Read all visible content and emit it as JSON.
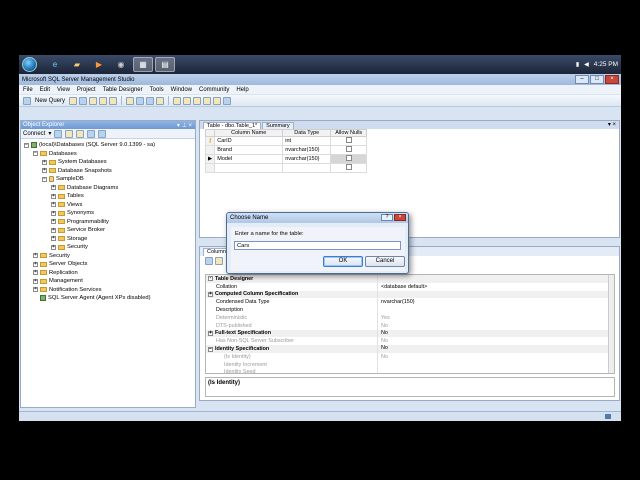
{
  "taskbar": {
    "clock": "4:25 PM"
  },
  "window": {
    "title": "Microsoft SQL Server Management Studio",
    "menu": [
      "File",
      "Edit",
      "View",
      "Project",
      "Table Designer",
      "Tools",
      "Window",
      "Community",
      "Help"
    ],
    "toolbar_new_query": "New Query"
  },
  "object_explorer": {
    "title": "Object Explorer",
    "connect_label": "Connect",
    "tree": [
      {
        "label": "(local)\\Databases (SQL Server 9.0.1399 - sa)",
        "depth": 0,
        "icon": "server-icon",
        "expander": "-"
      },
      {
        "label": "Databases",
        "depth": 1,
        "icon": "folder-icon",
        "expander": "-"
      },
      {
        "label": "System Databases",
        "depth": 2,
        "icon": "folder-icon",
        "expander": "+"
      },
      {
        "label": "Database Snapshots",
        "depth": 2,
        "icon": "folder-icon",
        "expander": "+"
      },
      {
        "label": "SampleDB",
        "depth": 2,
        "icon": "database-icon",
        "expander": "-"
      },
      {
        "label": "Database Diagrams",
        "depth": 3,
        "icon": "folder-icon",
        "expander": "+"
      },
      {
        "label": "Tables",
        "depth": 3,
        "icon": "folder-icon",
        "expander": "+"
      },
      {
        "label": "Views",
        "depth": 3,
        "icon": "folder-icon",
        "expander": "+"
      },
      {
        "label": "Synonyms",
        "depth": 3,
        "icon": "folder-icon",
        "expander": "+"
      },
      {
        "label": "Programmability",
        "depth": 3,
        "icon": "folder-icon",
        "expander": "+"
      },
      {
        "label": "Service Broker",
        "depth": 3,
        "icon": "folder-icon",
        "expander": "+"
      },
      {
        "label": "Storage",
        "depth": 3,
        "icon": "folder-icon",
        "expander": "+"
      },
      {
        "label": "Security",
        "depth": 3,
        "icon": "folder-icon",
        "expander": "+"
      },
      {
        "label": "Security",
        "depth": 1,
        "icon": "folder-icon",
        "expander": "+"
      },
      {
        "label": "Server Objects",
        "depth": 1,
        "icon": "folder-icon",
        "expander": "+"
      },
      {
        "label": "Replication",
        "depth": 1,
        "icon": "folder-icon",
        "expander": "+"
      },
      {
        "label": "Management",
        "depth": 1,
        "icon": "folder-icon",
        "expander": "+"
      },
      {
        "label": "Notification Services",
        "depth": 1,
        "icon": "folder-icon",
        "expander": "+"
      },
      {
        "label": "SQL Server Agent (Agent XPs disabled)",
        "depth": 1,
        "icon": "agent-icon",
        "expander": ""
      }
    ]
  },
  "designer": {
    "tabs": [
      "Table - dbo.Table_1*",
      "Summary"
    ],
    "columns_header": [
      "Column Name",
      "Data Type",
      "Allow Nulls"
    ],
    "rows": [
      {
        "name": "CarID",
        "type": "int",
        "marker": "key-icon"
      },
      {
        "name": "Brand",
        "type": "nvarchar(150)",
        "marker": ""
      },
      {
        "name": "Model",
        "type": "nvarchar(150)",
        "marker": "arrow"
      }
    ]
  },
  "column_properties": {
    "tab_label": "Column Properties",
    "section_label": "Table Designer",
    "rows": [
      {
        "key": "Collation",
        "value": "<database default>",
        "kind": "sub"
      },
      {
        "key": "Computed Column Specification",
        "value": "",
        "kind": "cat",
        "box": "+"
      },
      {
        "key": "Condensed Data Type",
        "value": "nvarchar(150)",
        "kind": "sub"
      },
      {
        "key": "Description",
        "value": "",
        "kind": "sub"
      },
      {
        "key": "Deterministic",
        "value": "Yes",
        "kind": "dim"
      },
      {
        "key": "DTS-published",
        "value": "No",
        "kind": "dim"
      },
      {
        "key": "Full-text Specification",
        "value": "No",
        "kind": "cat",
        "box": "+"
      },
      {
        "key": "Has Non-SQL Server Subscriber",
        "value": "No",
        "kind": "dim"
      },
      {
        "key": "Identity Specification",
        "value": "No",
        "kind": "cat",
        "box": "-"
      },
      {
        "key": "(Is Identity)",
        "value": "No",
        "kind": "dim"
      },
      {
        "key": "Identity Increment",
        "value": "",
        "kind": "dim"
      },
      {
        "key": "Identity Seed",
        "value": "",
        "kind": "dim"
      }
    ],
    "description_label": "(Is Identity)"
  },
  "dialog": {
    "title": "Choose Name",
    "prompt": "Enter a name for the table:",
    "input_value": "Cars",
    "ok_label": "OK",
    "cancel_label": "Cancel"
  }
}
